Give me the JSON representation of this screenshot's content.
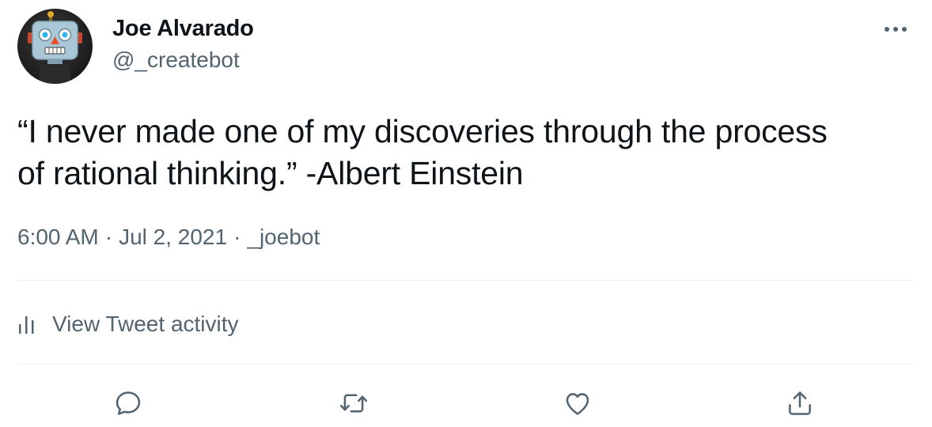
{
  "author": {
    "display_name": "Joe Alvarado",
    "username": "@_createbot",
    "avatar_icon": "robot-avatar"
  },
  "tweet": {
    "text_line1": "“I never made one of my discoveries through the process",
    "text_line2": "of rational thinking.” -Albert Einstein",
    "time": "6:00 AM",
    "date": "Jul 2, 2021",
    "source": "_joebot",
    "separator": "·"
  },
  "activity": {
    "label": "View Tweet activity",
    "icon": "bar-chart-icon"
  },
  "actions": {
    "reply_icon": "reply-icon",
    "retweet_icon": "retweet-icon",
    "like_icon": "heart-icon",
    "share_icon": "share-icon"
  },
  "colors": {
    "text_primary": "#0f1419",
    "text_secondary": "#536471",
    "divider": "#eff3f4"
  }
}
